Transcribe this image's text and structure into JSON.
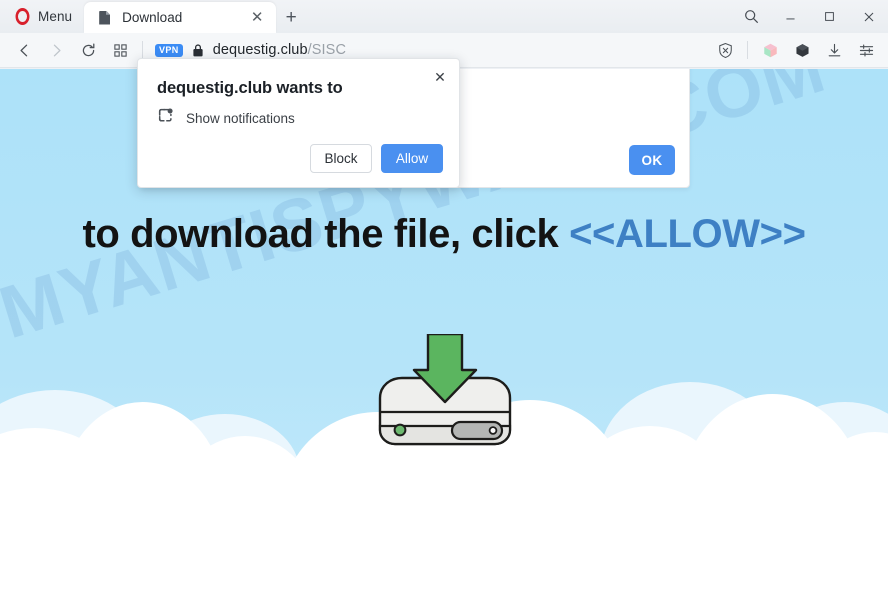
{
  "browser": {
    "name": "Opera",
    "menu_label": "Menu",
    "tabs": [
      {
        "title": "Download",
        "favicon": "page-icon",
        "close_glyph": "✕",
        "active": true
      }
    ],
    "new_tab_glyph": "+",
    "window_controls": [
      {
        "name": "search-icon",
        "glyph": "search"
      },
      {
        "name": "minimize-icon",
        "glyph": "minimize"
      },
      {
        "name": "maximize-icon",
        "glyph": "maximize"
      },
      {
        "name": "close-icon",
        "glyph": "close"
      }
    ],
    "toolbar": {
      "back_icon": "chevron-left-icon",
      "forward_icon": "chevron-right-icon",
      "reload_icon": "reload-icon",
      "speeddial_icon": "grid-icon",
      "vpn_badge": "VPN",
      "lock_icon": "lock-icon",
      "url_host": "dequestig.club",
      "url_path": "/SISC",
      "right_icons": [
        {
          "name": "ad-block-shield-icon"
        },
        {
          "name": "crypto-wallet-cube-icon"
        },
        {
          "name": "extensions-cube-icon"
        },
        {
          "name": "downloads-icon"
        },
        {
          "name": "easy-setup-sliders-icon"
        }
      ]
    }
  },
  "page": {
    "background_color": "#ade2f9",
    "watermark": "MYANTISPYWARE.COM",
    "headline_prefix": "to download the file, click ",
    "headline_allow": "<<ALLOW>>",
    "headline_allow_color": "#3e80c4",
    "site_dialog": {
      "ok_label": "OK",
      "ok_color": "#4a90f0"
    },
    "illustration": {
      "name": "hard-drive-download-icon",
      "arrow_color": "#5bb55f",
      "drive_color": "#e8e8e6"
    }
  },
  "permission_popup": {
    "title": "dequestig.club wants to",
    "permission_icon": "notifications-icon",
    "permission_label": "Show notifications",
    "close_glyph": "✕",
    "block_label": "Block",
    "allow_label": "Allow",
    "allow_color": "#4a90f0"
  }
}
